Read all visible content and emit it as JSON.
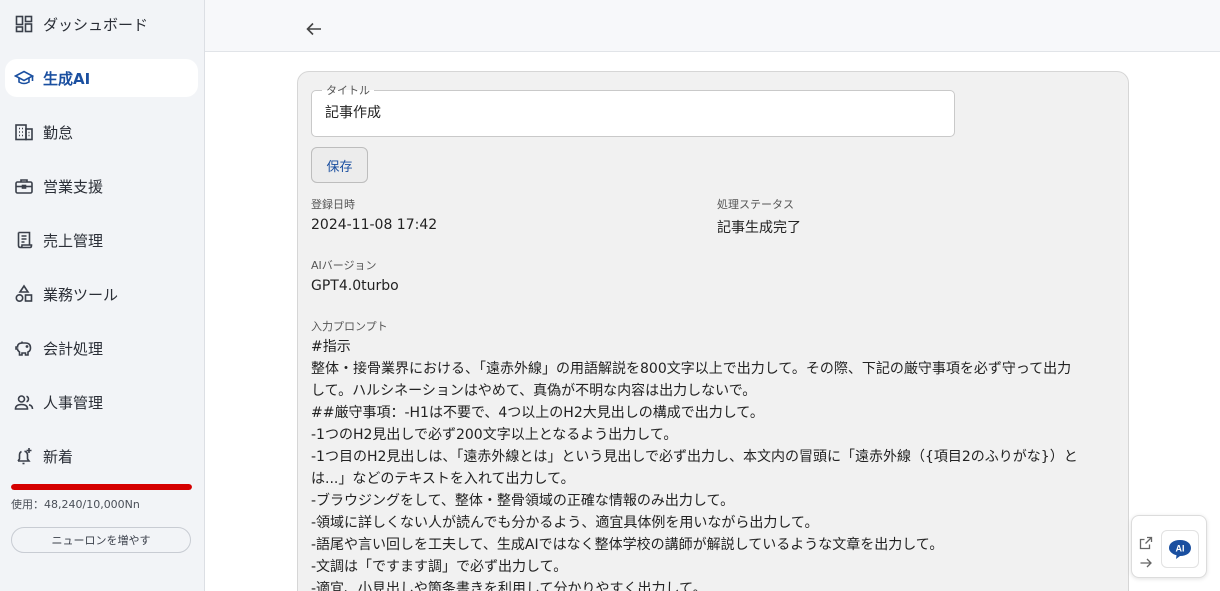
{
  "sidebar": {
    "items": [
      {
        "label": "ダッシュボード",
        "icon": "dashboard-icon",
        "active": false
      },
      {
        "label": "生成AI",
        "icon": "school-icon",
        "active": true
      },
      {
        "label": "勤怠",
        "icon": "building-icon",
        "active": false
      },
      {
        "label": "営業支援",
        "icon": "briefcase-icon",
        "active": false
      },
      {
        "label": "売上管理",
        "icon": "receipt-icon",
        "active": false
      },
      {
        "label": "業務ツール",
        "icon": "shapes-icon",
        "active": false
      },
      {
        "label": "会計処理",
        "icon": "piggy-bank-icon",
        "active": false
      },
      {
        "label": "人事管理",
        "icon": "people-icon",
        "active": false
      },
      {
        "label": "新着",
        "icon": "bell-plus-icon",
        "active": false
      }
    ],
    "usage": {
      "text": "使用：48,240/10,000Nn",
      "fill_fraction": 1.0,
      "color": "#d50000"
    },
    "increase_label": "ニューロンを増やす"
  },
  "header": {
    "back_icon": "arrow-left-icon"
  },
  "form": {
    "title_legend": "タイトル",
    "title_value": "記事作成",
    "save_label": "保存",
    "registered_label": "登録日時",
    "registered_value": "2024-11-08 17:42",
    "status_label": "処理ステータス",
    "status_value": "記事生成完了",
    "ai_version_label": "AIバージョン",
    "ai_version_value": "GPT4.0turbo",
    "prompt_label": "入力プロンプト",
    "prompt_lines": [
      "#指示",
      "整体・接骨業界における、「遠赤外線」の用語解説を800文字以上で出力して。その際、下記の厳守事項を必ず守って出力",
      "して。ハルシネーションはやめて、真偽が不明な内容は出力しないで。",
      "##厳守事項：-H1は不要で、4つ以上のH2大見出しの構成で出力して。",
      "-1つのH2見出しで必ず200文字以上となるよう出力して。",
      "-1つ目のH2見出しは、「遠赤外線とは」という見出しで必ず出力し、本文内の冒頭に「遠赤外線（{項目2のふりがな}）と",
      "は...」などのテキストを入れて出力して。",
      "-ブラウジングをして、整体・整骨領域の正確な情報のみ出力して。",
      "-領域に詳しくない人が読んでも分かるよう、適宜具体例を用いながら出力して。",
      "-語尾や言い回しを工夫して、生成AIではなく整体学校の講師が解説しているような文章を出力して。",
      "-文調は「ですます調」で必ず出力して。",
      "-適宜、小見出しや箇条書きを利用して分かりやすく出力して。"
    ]
  },
  "widget": {
    "open_icon": "external-link-icon",
    "arrow_icon": "arrow-right-icon",
    "ai_icon": "ai-chat-icon",
    "ai_label": "AI",
    "accent": "#1a4fa0"
  }
}
